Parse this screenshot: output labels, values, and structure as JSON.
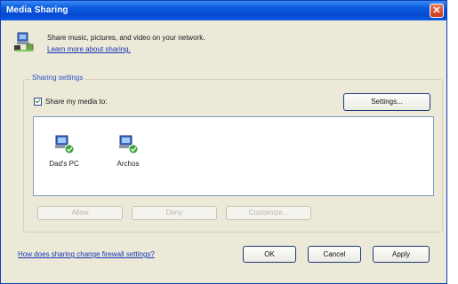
{
  "window": {
    "title": "Media Sharing",
    "close_icon": "close-icon"
  },
  "header": {
    "description": "Share music, pictures, and video on your network.",
    "learn_more": "Learn more about sharing."
  },
  "sharing_settings": {
    "group_label": "Sharing settings",
    "share_checkbox_label": "Share my media to:",
    "share_checked": true,
    "settings_button": "Settings...",
    "devices": [
      {
        "label": "Dad's PC",
        "icon": "shared-pc-icon"
      },
      {
        "label": "Archos",
        "icon": "shared-device-icon"
      }
    ],
    "allow_button": "Allow",
    "deny_button": "Deny",
    "customize_button": "Customize..."
  },
  "footer": {
    "firewall_link": "How does sharing change firewall settings?",
    "ok_button": "OK",
    "cancel_button": "Cancel",
    "apply_button": "Apply"
  },
  "colors": {
    "titlebar": "#0549d3",
    "window_bg": "#ece9d8",
    "link": "#1b35b5",
    "group_label": "#2b50c5"
  }
}
